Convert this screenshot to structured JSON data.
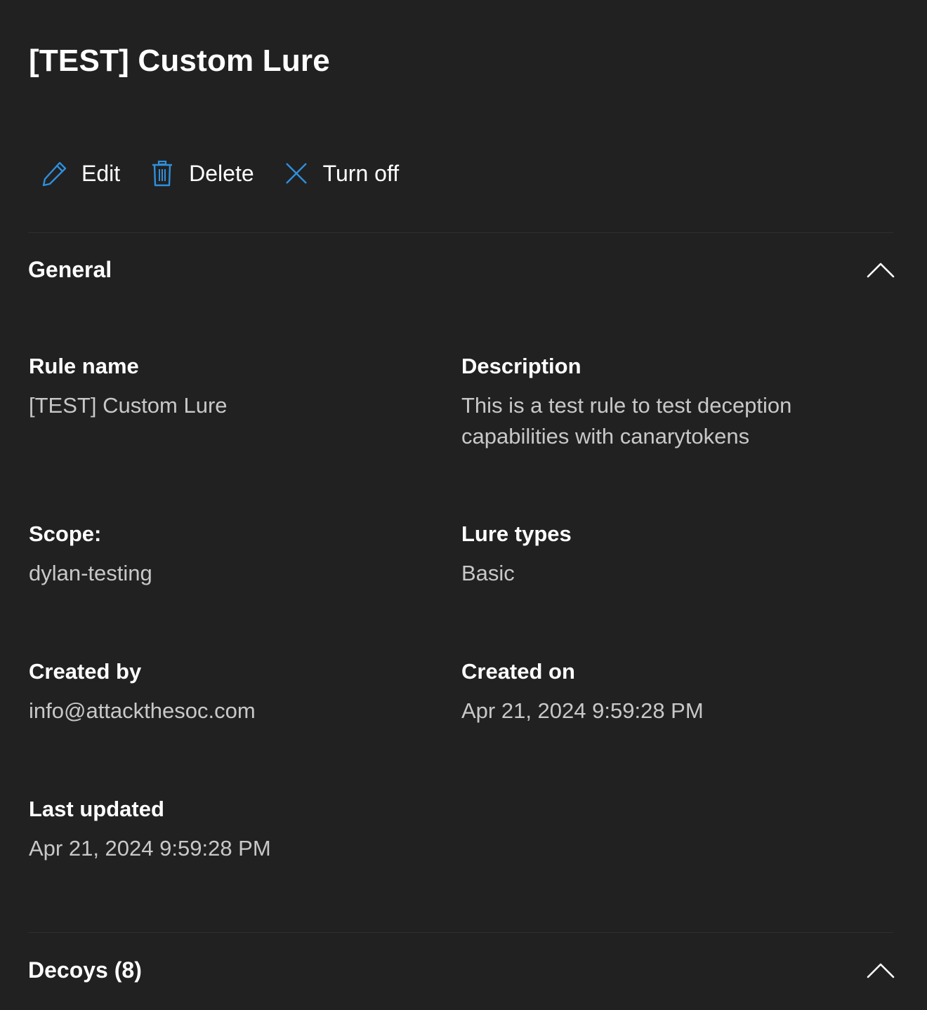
{
  "title": "[TEST] Custom Lure",
  "toolbar": {
    "edit_label": "Edit",
    "edit_icon": "pencil-icon",
    "delete_label": "Delete",
    "delete_icon": "trash-icon",
    "turn_off_label": "Turn off",
    "turn_off_icon": "close-icon",
    "accent_color": "#2f8fdc"
  },
  "sections": {
    "general": {
      "title": "General",
      "expanded": true,
      "fields": {
        "rule_name": {
          "label": "Rule name",
          "value": "[TEST] Custom Lure"
        },
        "description": {
          "label": "Description",
          "value": "This is a test rule to test deception capabilities with canarytokens"
        },
        "scope": {
          "label": "Scope:",
          "value": "dylan-testing"
        },
        "lure_types": {
          "label": "Lure types",
          "value": "Basic"
        },
        "created_by": {
          "label": "Created by",
          "value": "info@attackthesoc.com"
        },
        "created_on": {
          "label": "Created on",
          "value": "Apr 21, 2024 9:59:28 PM"
        },
        "last_updated": {
          "label": "Last updated",
          "value": "Apr 21, 2024 9:59:28 PM"
        }
      }
    },
    "decoys": {
      "title": "Decoys (8)",
      "expanded": true
    }
  },
  "colors": {
    "background": "#212121",
    "text_primary": "#ffffff",
    "text_secondary": "#c8c8c8",
    "divider": "#2e2e2e"
  }
}
